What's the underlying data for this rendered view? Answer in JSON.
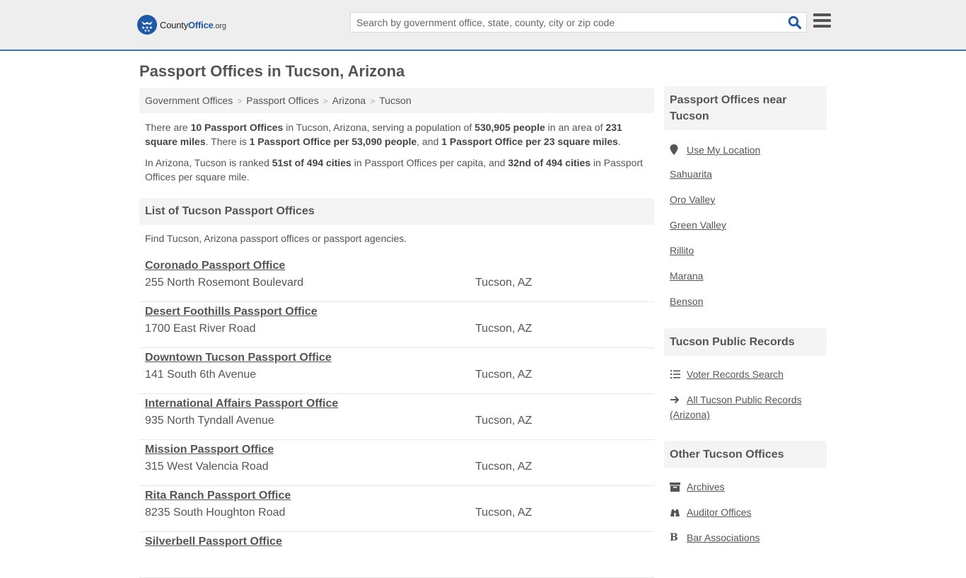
{
  "header": {
    "logo": {
      "prefix": "County",
      "brand": "Office",
      "suffix": ".org"
    },
    "search": {
      "placeholder": "Search by government office, state, county, city or zip code",
      "value": ""
    },
    "brand_color": "#1d5aa6",
    "accent_line_color": "#3d78b0"
  },
  "page": {
    "title": "Passport Offices in Tucson, Arizona",
    "breadcrumb": [
      "Government Offices",
      "Passport Offices",
      "Arizona",
      "Tucson"
    ],
    "intro": {
      "p1": [
        {
          "t": "There are ",
          "b": false
        },
        {
          "t": "10 Passport Offices",
          "b": true
        },
        {
          "t": " in Tucson, Arizona, serving a population of ",
          "b": false
        },
        {
          "t": "530,905 people",
          "b": true
        },
        {
          "t": " in an area of ",
          "b": false
        },
        {
          "t": "231 square miles",
          "b": true
        },
        {
          "t": ". There is ",
          "b": false
        },
        {
          "t": "1 Passport Office per 53,090 people",
          "b": true
        },
        {
          "t": ", and ",
          "b": false
        },
        {
          "t": "1 Passport Office per 23 square miles",
          "b": true
        },
        {
          "t": ".",
          "b": false
        }
      ],
      "p2": [
        {
          "t": "In Arizona, Tucson is ranked ",
          "b": false
        },
        {
          "t": "51st of 494 cities",
          "b": true
        },
        {
          "t": " in Passport Offices per capita, and ",
          "b": false
        },
        {
          "t": "32nd of 494 cities",
          "b": true
        },
        {
          "t": " in Passport Offices per square mile.",
          "b": false
        }
      ]
    },
    "list_heading": "List of Tucson Passport Offices",
    "list_description": "Find Tucson, Arizona passport offices or passport agencies.",
    "offices": [
      {
        "name": "Coronado Passport Office",
        "address": "255 North Rosemont Boulevard",
        "city": "Tucson, AZ"
      },
      {
        "name": "Desert Foothills Passport Office",
        "address": "1700 East River Road",
        "city": "Tucson, AZ"
      },
      {
        "name": "Downtown Tucson Passport Office",
        "address": "141 South 6th Avenue",
        "city": "Tucson, AZ"
      },
      {
        "name": "International Affairs Passport Office",
        "address": "935 North Tyndall Avenue",
        "city": "Tucson, AZ"
      },
      {
        "name": "Mission Passport Office",
        "address": "315 West Valencia Road",
        "city": "Tucson, AZ"
      },
      {
        "name": "Rita Ranch Passport Office",
        "address": "8235 South Houghton Road",
        "city": "Tucson, AZ"
      },
      {
        "name": "Silverbell Passport Office",
        "address": "",
        "city": ""
      }
    ]
  },
  "sidebar": {
    "nearby": {
      "heading": "Passport Offices near Tucson",
      "use_location": {
        "label": "Use My Location",
        "icon": "map-marker-icon"
      },
      "cities": [
        "Sahuarita",
        "Oro Valley",
        "Green Valley",
        "Rillito",
        "Marana",
        "Benson"
      ]
    },
    "records": {
      "heading": "Tucson Public Records",
      "links": [
        {
          "label": "Voter Records Search",
          "icon": "list-icon"
        },
        {
          "label": "All Tucson Public Records (Arizona)",
          "icon": "arrow-right-icon"
        }
      ]
    },
    "other": {
      "heading": "Other Tucson Offices",
      "links": [
        {
          "label": "Archives",
          "icon": "archive-box-icon"
        },
        {
          "label": "Auditor Offices",
          "icon": "binoculars-icon"
        },
        {
          "label": "Bar Associations",
          "icon": "bold-b-icon"
        }
      ]
    }
  }
}
